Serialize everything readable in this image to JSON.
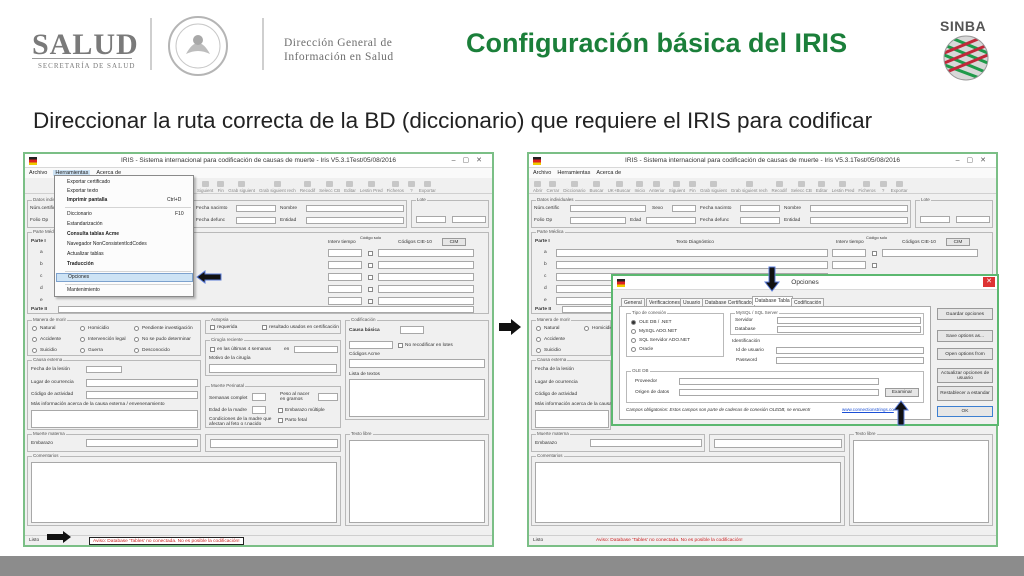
{
  "header": {
    "logo_main": "SALUD",
    "logo_sub": "SECRETARÍA DE SALUD",
    "dgis_line1": "Dirección General de",
    "dgis_line2": "Información en Salud",
    "title": "Configuración básica del IRIS",
    "sinba": "SINBA"
  },
  "subtitle": "Direccionar la ruta correcta de la BD (diccionario) que requiere el IRIS para codificar",
  "window": {
    "title": "IRIS - Sistema internacional para codificación de causas de muerte - Iris V5.3.1Test/05/08/2016",
    "menus": [
      "Archivo",
      "Herramientas",
      "Acerca de"
    ],
    "toolbar": [
      "Abrir",
      "Cerrar",
      "Diccionario",
      "Buscar",
      "UK+Buscar",
      "Inicio",
      "Anterior",
      "Siguient",
      "Fin",
      "Grab siguient",
      "Grab siguient rech",
      "Recodif",
      "Selecc CB",
      "Editar",
      "Lestin Pred",
      "Ficheros",
      "?",
      "Exportar"
    ],
    "groups": {
      "datos": "Datos individuales",
      "lote": "Lote",
      "parte_medica": "Parte Médica",
      "manera": "Manera de morir",
      "autopsia": "Autopsia",
      "codificacion": "Codificación",
      "cirugia": "Cirugía reciente",
      "causa_externa": "Causa externa",
      "muerte_perinatal": "Muerte Perinatal",
      "muerte_materna": "Muerte materna",
      "texto_libre": "Texto libre",
      "comentarios": "Comentarios"
    },
    "labels": {
      "num_cert": "Núm.certific",
      "folio": "Folio Op",
      "sexo": "Sexo",
      "edad": "Edad",
      "fecha_nac": "Fecha nacimto",
      "fecha_def": "Fecha defunc",
      "nombre": "Nombre",
      "entidad": "Entidad",
      "texto_diag": "Texto Diagnóstico",
      "intervalo": "Interv tiempo",
      "codigo_solo": "Código solo",
      "codigos_cie": "Códigos CIE-10",
      "cim": "CIM",
      "parte1": "Parte I",
      "parte2": "Parte II",
      "rows": [
        "a",
        "b",
        "c",
        "d",
        "e"
      ],
      "natural": "Natural",
      "accidente": "Accidente",
      "suicidio": "Suicidio",
      "homicidio": "Homicidio",
      "intervencion": "Intervención legal",
      "guerra": "Guerra",
      "pendiente": "Pendiente investigación",
      "no_se_pudo": "No se pudo determinar",
      "desconocido": "Desconocido",
      "requerida": "requerida",
      "resultado": "resultado usados en certificación",
      "ultimas_semanas": "en las últimas 4 semanas",
      "en": "en",
      "motivo_cirugia": "Motivo de la cirugía",
      "fecha_lesion": "Fecha de la lesión",
      "lugar": "Lugar de ocurrencia",
      "codigo_actividad": "Código de actividad",
      "mas_info": "Más información acerca de la causa externa / envenenamiento",
      "causa_basica": "Causa básica",
      "codigos_acme": "Códigos Acme",
      "no_recodificar": "No recodificar en lotes",
      "lista_textos": "Lista de textos",
      "semanas": "Semanas complet",
      "peso": "Peso al nacer en gramos",
      "edad_madre": "Edad de la madre",
      "embarazo_multiple": "Embarazo múltiple",
      "parto_fetal": "Parto fetal",
      "condiciones": "Condiciones de la madre que afectan al feto o r.nacido",
      "embarazo": "Embarazo"
    },
    "status_left": "Listo",
    "status_msg": "Aviso: Database 'Tables' no conectada. No es posible la codificación!"
  },
  "tools_menu": {
    "items": [
      "Exportar certificado",
      "Exportar texto",
      "Imprimir pantalla",
      "Diccionario",
      "Estandarización",
      "Consulta tablas Acme",
      "Navegador NonConsistentIcdCodes",
      "Actualizar tablas",
      "Traducción",
      "Opciones",
      "Mantenimiento"
    ],
    "shortcuts": {
      "print": "Ctrl+D",
      "dict": "F10"
    },
    "highlighted": "Opciones"
  },
  "options_dialog": {
    "title": "Opciones",
    "tabs": [
      "General",
      "Verificaciones",
      "Usuario",
      "Database Certificado",
      "Database Tabla",
      "Codificación"
    ],
    "selected_tab": "Database Tabla",
    "conn_group": "Tipo de conexión",
    "conn_options": [
      "OLE DB / .NET",
      "MySQL ADO.NET",
      "SQL Servidor ADO.NET",
      "Oracle"
    ],
    "sql_group": "MySQL / SQL Server",
    "servidor": "Servidor",
    "database": "Database",
    "identificacion": "Identificación",
    "id_usuario": "Id de usuario",
    "password": "Password",
    "oledb_group": "OLE DB",
    "proveedor": "Proveedor",
    "origen": "Origen de datos",
    "examinar": "Examinar",
    "note": "Campos obligatorios: Estos campos son parte de cadenas de conexión OLEDB, se encuentr",
    "link": "www.connectionstrings.co",
    "buttons": [
      "Guardar opciones",
      "Save options as...",
      "Open options from",
      "Actualizar opciones de usuario",
      "Restablecer a estandar",
      "OK"
    ]
  },
  "colors": {
    "title_green": "#1b7f3a",
    "window_border": "#7bbf86",
    "status_red": "#cc2222"
  }
}
